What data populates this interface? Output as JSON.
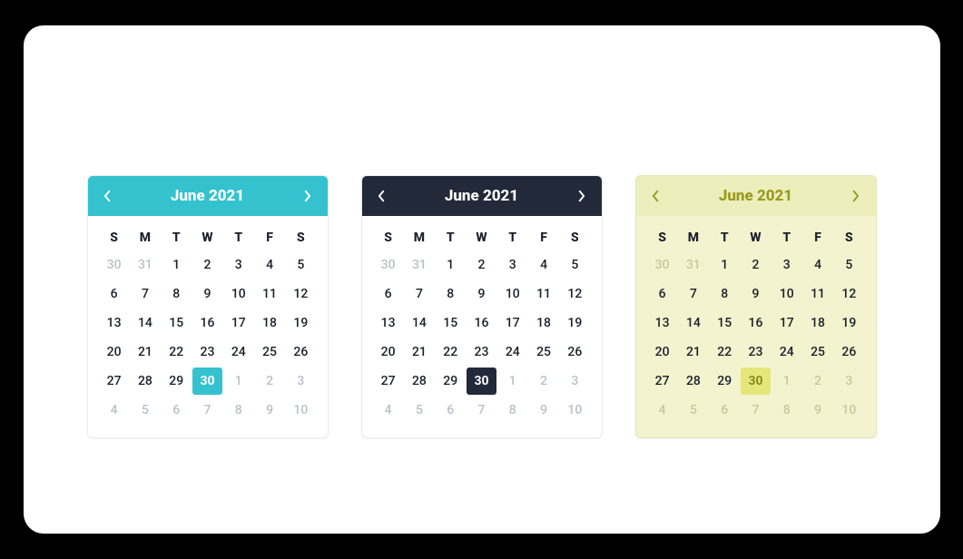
{
  "calendars": [
    {
      "theme": "t1",
      "title": "June 2021",
      "dow": [
        "S",
        "M",
        "T",
        "W",
        "T",
        "F",
        "S"
      ],
      "weeks": [
        [
          {
            "n": 30,
            "out": true
          },
          {
            "n": 31,
            "out": true
          },
          {
            "n": 1
          },
          {
            "n": 2
          },
          {
            "n": 3
          },
          {
            "n": 4
          },
          {
            "n": 5
          }
        ],
        [
          {
            "n": 6
          },
          {
            "n": 7
          },
          {
            "n": 8
          },
          {
            "n": 9
          },
          {
            "n": 10
          },
          {
            "n": 11
          },
          {
            "n": 12
          }
        ],
        [
          {
            "n": 13
          },
          {
            "n": 14
          },
          {
            "n": 15
          },
          {
            "n": 16
          },
          {
            "n": 17
          },
          {
            "n": 18
          },
          {
            "n": 19
          }
        ],
        [
          {
            "n": 20
          },
          {
            "n": 21
          },
          {
            "n": 22
          },
          {
            "n": 23
          },
          {
            "n": 24
          },
          {
            "n": 25
          },
          {
            "n": 26
          }
        ],
        [
          {
            "n": 27
          },
          {
            "n": 28
          },
          {
            "n": 29
          },
          {
            "n": 30,
            "sel": true
          },
          {
            "n": 1,
            "out": true
          },
          {
            "n": 2,
            "out": true
          },
          {
            "n": 3,
            "out": true
          }
        ],
        [
          {
            "n": 4,
            "out": true
          },
          {
            "n": 5,
            "out": true
          },
          {
            "n": 6,
            "out": true
          },
          {
            "n": 7,
            "out": true
          },
          {
            "n": 8,
            "out": true
          },
          {
            "n": 9,
            "out": true
          },
          {
            "n": 10,
            "out": true
          }
        ]
      ]
    },
    {
      "theme": "t2",
      "title": "June 2021",
      "dow": [
        "S",
        "M",
        "T",
        "W",
        "T",
        "F",
        "S"
      ],
      "weeks": [
        [
          {
            "n": 30,
            "out": true
          },
          {
            "n": 31,
            "out": true
          },
          {
            "n": 1
          },
          {
            "n": 2
          },
          {
            "n": 3
          },
          {
            "n": 4
          },
          {
            "n": 5
          }
        ],
        [
          {
            "n": 6
          },
          {
            "n": 7
          },
          {
            "n": 8
          },
          {
            "n": 9
          },
          {
            "n": 10
          },
          {
            "n": 11
          },
          {
            "n": 12
          }
        ],
        [
          {
            "n": 13
          },
          {
            "n": 14
          },
          {
            "n": 15
          },
          {
            "n": 16
          },
          {
            "n": 17
          },
          {
            "n": 18
          },
          {
            "n": 19
          }
        ],
        [
          {
            "n": 20
          },
          {
            "n": 21
          },
          {
            "n": 22
          },
          {
            "n": 23
          },
          {
            "n": 24
          },
          {
            "n": 25
          },
          {
            "n": 26
          }
        ],
        [
          {
            "n": 27
          },
          {
            "n": 28
          },
          {
            "n": 29
          },
          {
            "n": 30,
            "sel": true
          },
          {
            "n": 1,
            "out": true
          },
          {
            "n": 2,
            "out": true
          },
          {
            "n": 3,
            "out": true
          }
        ],
        [
          {
            "n": 4,
            "out": true
          },
          {
            "n": 5,
            "out": true
          },
          {
            "n": 6,
            "out": true
          },
          {
            "n": 7,
            "out": true
          },
          {
            "n": 8,
            "out": true
          },
          {
            "n": 9,
            "out": true
          },
          {
            "n": 10,
            "out": true
          }
        ]
      ]
    },
    {
      "theme": "t3",
      "title": "June 2021",
      "dow": [
        "S",
        "M",
        "T",
        "W",
        "T",
        "F",
        "S"
      ],
      "weeks": [
        [
          {
            "n": 30,
            "out": true
          },
          {
            "n": 31,
            "out": true
          },
          {
            "n": 1
          },
          {
            "n": 2
          },
          {
            "n": 3
          },
          {
            "n": 4
          },
          {
            "n": 5
          }
        ],
        [
          {
            "n": 6
          },
          {
            "n": 7
          },
          {
            "n": 8
          },
          {
            "n": 9
          },
          {
            "n": 10
          },
          {
            "n": 11
          },
          {
            "n": 12
          }
        ],
        [
          {
            "n": 13
          },
          {
            "n": 14
          },
          {
            "n": 15
          },
          {
            "n": 16
          },
          {
            "n": 17
          },
          {
            "n": 18
          },
          {
            "n": 19
          }
        ],
        [
          {
            "n": 20
          },
          {
            "n": 21
          },
          {
            "n": 22
          },
          {
            "n": 23
          },
          {
            "n": 24
          },
          {
            "n": 25
          },
          {
            "n": 26
          }
        ],
        [
          {
            "n": 27
          },
          {
            "n": 28
          },
          {
            "n": 29
          },
          {
            "n": 30,
            "sel": true
          },
          {
            "n": 1,
            "out": true
          },
          {
            "n": 2,
            "out": true
          },
          {
            "n": 3,
            "out": true
          }
        ],
        [
          {
            "n": 4,
            "out": true
          },
          {
            "n": 5,
            "out": true
          },
          {
            "n": 6,
            "out": true
          },
          {
            "n": 7,
            "out": true
          },
          {
            "n": 8,
            "out": true
          },
          {
            "n": 9,
            "out": true
          },
          {
            "n": 10,
            "out": true
          }
        ]
      ]
    }
  ]
}
